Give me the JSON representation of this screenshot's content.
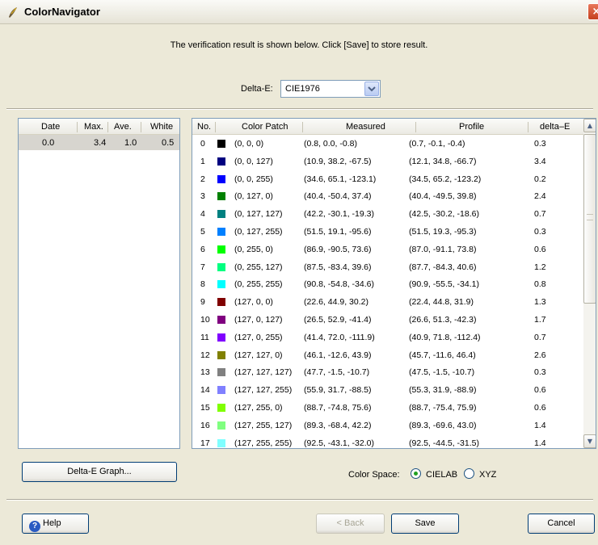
{
  "window": {
    "title": "ColorNavigator",
    "close_glyph": "×"
  },
  "instruction": "The verification result is shown below.  Click [Save] to store result.",
  "delta_e": {
    "label": "Delta-E:",
    "value": "CIE1976"
  },
  "history": {
    "headers": [
      "Date",
      "Max.",
      "Ave.",
      "White"
    ],
    "rows": [
      {
        "date": "0.0",
        "max": "3.4",
        "ave": "1.0",
        "white": "0.5"
      }
    ]
  },
  "table": {
    "headers": [
      "No.",
      "Color Patch",
      "Measured",
      "Profile",
      "delta–E"
    ],
    "rows": [
      {
        "no": "0",
        "color": "#000000",
        "patch": "(0, 0, 0)",
        "measured": "(0.8, 0.0, -0.8)",
        "profile": "(0.7, -0.1, -0.4)",
        "delta": "0.3"
      },
      {
        "no": "1",
        "color": "#000080",
        "patch": "(0, 0, 127)",
        "measured": "(10.9, 38.2, -67.5)",
        "profile": "(12.1, 34.8, -66.7)",
        "delta": "3.4"
      },
      {
        "no": "2",
        "color": "#0000ff",
        "patch": "(0, 0, 255)",
        "measured": "(34.6, 65.1, -123.1)",
        "profile": "(34.5, 65.2, -123.2)",
        "delta": "0.2"
      },
      {
        "no": "3",
        "color": "#008000",
        "patch": "(0, 127, 0)",
        "measured": "(40.4, -50.4, 37.4)",
        "profile": "(40.4, -49.5, 39.8)",
        "delta": "2.4"
      },
      {
        "no": "4",
        "color": "#008080",
        "patch": "(0, 127, 127)",
        "measured": "(42.2, -30.1, -19.3)",
        "profile": "(42.5, -30.2, -18.6)",
        "delta": "0.7"
      },
      {
        "no": "5",
        "color": "#0080ff",
        "patch": "(0, 127, 255)",
        "measured": "(51.5, 19.1, -95.6)",
        "profile": "(51.5, 19.3, -95.3)",
        "delta": "0.3"
      },
      {
        "no": "6",
        "color": "#00ff00",
        "patch": "(0, 255, 0)",
        "measured": "(86.9, -90.5, 73.6)",
        "profile": "(87.0, -91.1, 73.8)",
        "delta": "0.6"
      },
      {
        "no": "7",
        "color": "#00ff80",
        "patch": "(0, 255, 127)",
        "measured": "(87.5, -83.4, 39.6)",
        "profile": "(87.7, -84.3, 40.6)",
        "delta": "1.2"
      },
      {
        "no": "8",
        "color": "#00ffff",
        "patch": "(0, 255, 255)",
        "measured": "(90.8, -54.8, -34.6)",
        "profile": "(90.9, -55.5, -34.1)",
        "delta": "0.8"
      },
      {
        "no": "9",
        "color": "#800000",
        "patch": "(127, 0, 0)",
        "measured": "(22.6, 44.9, 30.2)",
        "profile": "(22.4, 44.8, 31.9)",
        "delta": "1.3"
      },
      {
        "no": "10",
        "color": "#800080",
        "patch": "(127, 0, 127)",
        "measured": "(26.5, 52.9, -41.4)",
        "profile": "(26.6, 51.3, -42.3)",
        "delta": "1.7"
      },
      {
        "no": "11",
        "color": "#8000ff",
        "patch": "(127, 0, 255)",
        "measured": "(41.4, 72.0, -111.9)",
        "profile": "(40.9, 71.8, -112.4)",
        "delta": "0.7"
      },
      {
        "no": "12",
        "color": "#808000",
        "patch": "(127, 127, 0)",
        "measured": "(46.1, -12.6, 43.9)",
        "profile": "(45.7, -11.6, 46.4)",
        "delta": "2.6"
      },
      {
        "no": "13",
        "color": "#808080",
        "patch": "(127, 127, 127)",
        "measured": "(47.7, -1.5, -10.7)",
        "profile": "(47.5, -1.5, -10.7)",
        "delta": "0.3"
      },
      {
        "no": "14",
        "color": "#8080ff",
        "patch": "(127, 127, 255)",
        "measured": "(55.9, 31.7, -88.5)",
        "profile": "(55.3, 31.9, -88.9)",
        "delta": "0.6"
      },
      {
        "no": "15",
        "color": "#80ff00",
        "patch": "(127, 255, 0)",
        "measured": "(88.7, -74.8, 75.6)",
        "profile": "(88.7, -75.4, 75.9)",
        "delta": "0.6"
      },
      {
        "no": "16",
        "color": "#80ff80",
        "patch": "(127, 255, 127)",
        "measured": "(89.3, -68.4, 42.2)",
        "profile": "(89.3, -69.6, 43.0)",
        "delta": "1.4"
      },
      {
        "no": "17",
        "color": "#80ffff",
        "patch": "(127, 255, 255)",
        "measured": "(92.5, -43.1, -32.0)",
        "profile": "(92.5, -44.5, -31.5)",
        "delta": "1.4"
      }
    ]
  },
  "buttons": {
    "graph": "Delta-E Graph...",
    "help": "Help",
    "back": "< Back",
    "save": "Save",
    "cancel": "Cancel"
  },
  "color_space": {
    "label": "Color Space:",
    "options": [
      "CIELAB",
      "XYZ"
    ],
    "selected": "CIELAB"
  },
  "icons": {
    "app": "colornavigator-app-icon",
    "help": "help-icon",
    "close": "close-icon"
  }
}
